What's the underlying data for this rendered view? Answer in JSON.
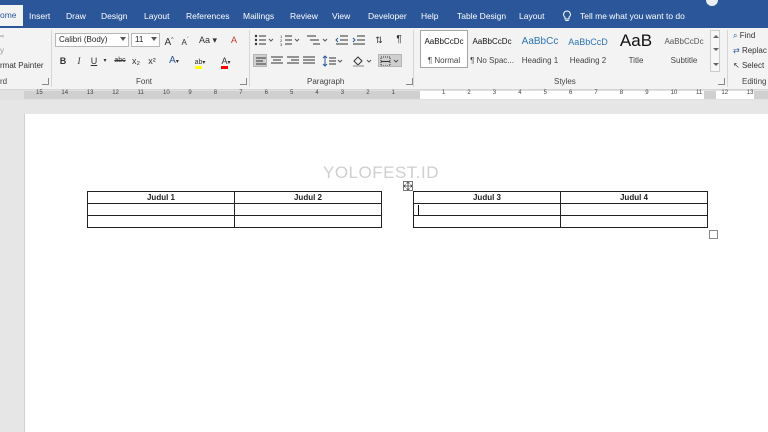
{
  "tabs": [
    {
      "label": "ome",
      "active": true
    },
    {
      "label": "Insert"
    },
    {
      "label": "Draw"
    },
    {
      "label": "Design"
    },
    {
      "label": "Layout"
    },
    {
      "label": "References"
    },
    {
      "label": "Mailings"
    },
    {
      "label": "Review"
    },
    {
      "label": "View"
    },
    {
      "label": "Developer"
    },
    {
      "label": "Help"
    },
    {
      "label": "Table Design"
    },
    {
      "label": "Layout"
    }
  ],
  "tell_me": {
    "text": "Tell me what you want to do",
    "icon": "lightbulb-icon"
  },
  "clipboard": {
    "copy_label": "y",
    "format_painter_label": "rmat Painter",
    "group_label": "rd"
  },
  "font": {
    "family": "Calibri (Body)",
    "size": "11",
    "grow_label": "A",
    "shrink_label": "A",
    "case_label": "Aa",
    "clear_label": "A",
    "bold": "B",
    "italic": "I",
    "underline": "U",
    "strike": "abc",
    "subscript": "x₂",
    "superscript": "x²",
    "effects": "A",
    "highlight": "ab",
    "color": "A",
    "group_label": "Font"
  },
  "paragraph": {
    "group_label": "Paragraph",
    "pilcrow": "¶"
  },
  "styles": {
    "items": [
      {
        "sample": "AaBbCcDc",
        "name": "¶ Normal",
        "selected": true
      },
      {
        "sample": "AaBbCcDc",
        "name": "¶ No Spac..."
      },
      {
        "sample": "AaBbCc",
        "name": "Heading 1"
      },
      {
        "sample": "AaBbCcD",
        "name": "Heading 2"
      },
      {
        "sample": "AaB",
        "name": "Title"
      },
      {
        "sample": "AaBbCcDc",
        "name": "Subtitle"
      }
    ],
    "group_label": "Styles"
  },
  "editing": {
    "find_label": "Find",
    "replace_label": "Replac",
    "select_label": "Select",
    "group_label": "Editing"
  },
  "ruler": {
    "left_numbers": [
      "15",
      "14",
      "13",
      "12",
      "11",
      "10",
      "9",
      "8",
      "7",
      "6",
      "5",
      "4",
      "3",
      "2",
      "1"
    ],
    "right_numbers": [
      "1",
      "2",
      "3",
      "4",
      "5",
      "6",
      "7",
      "8",
      "9",
      "10",
      "11",
      "12",
      "13"
    ]
  },
  "document": {
    "watermark": "YOLOFEST.ID",
    "table1": {
      "headers": [
        "Judul 1",
        "Judul 2"
      ],
      "rows": [
        [
          "",
          ""
        ],
        [
          "",
          ""
        ]
      ]
    },
    "table2": {
      "headers": [
        "Judul 3",
        "Judul 4"
      ],
      "rows": [
        [
          "",
          ""
        ],
        [
          "",
          ""
        ]
      ]
    }
  },
  "colors": {
    "accent": "#2b579a",
    "ribbon_bg": "#f3f3f3",
    "workspace_bg": "#e6e6e6",
    "highlight_yellow": "#ffff00",
    "font_red": "#ff0000"
  }
}
